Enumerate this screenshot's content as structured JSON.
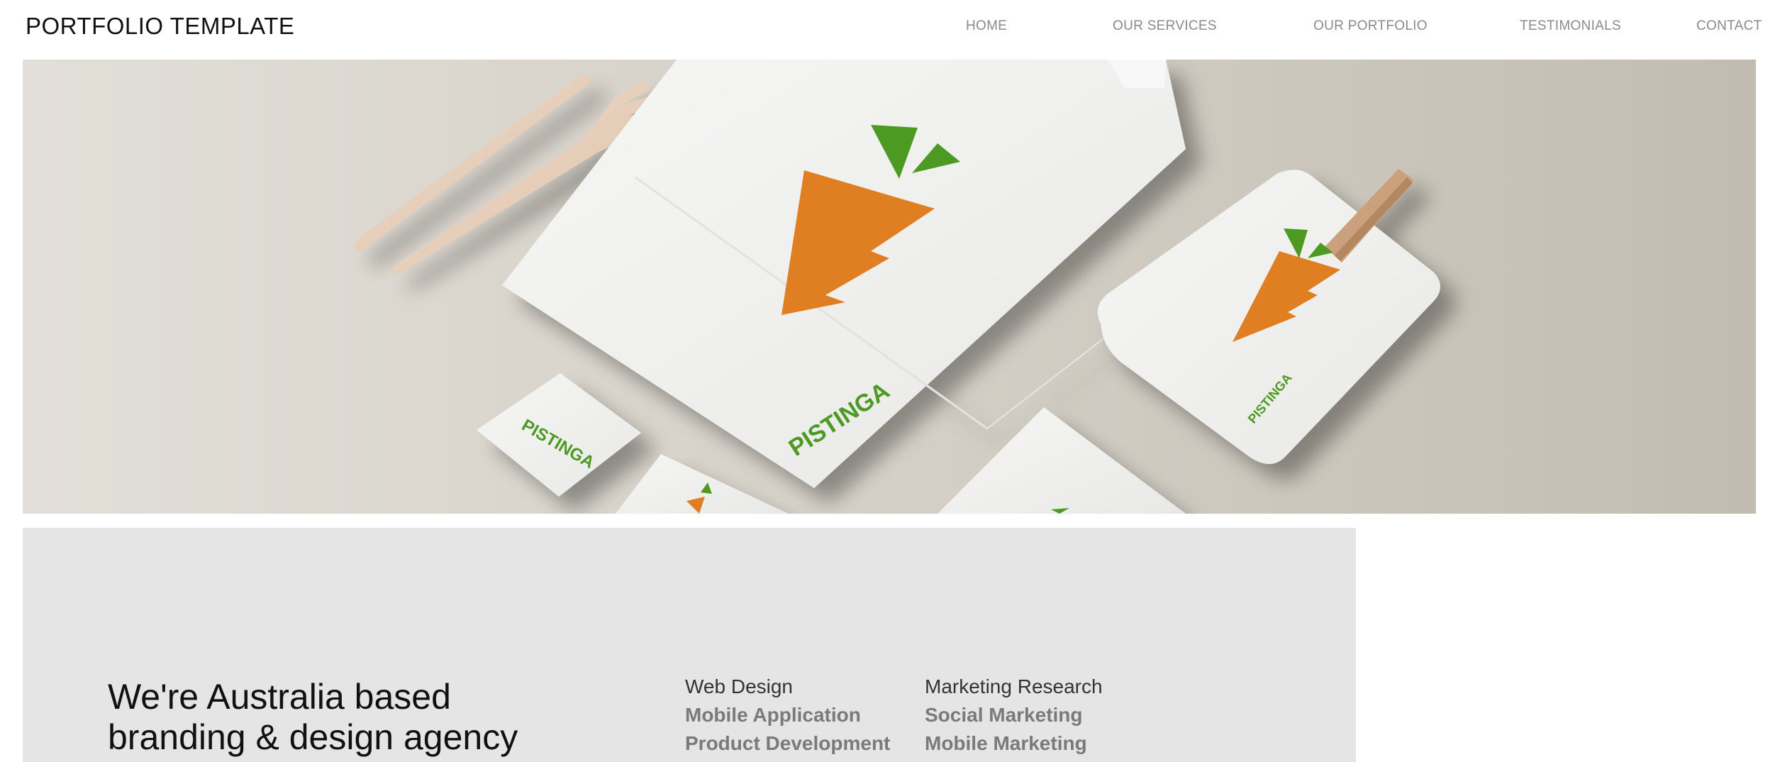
{
  "header": {
    "brand": "PORTFOLIO TEMPLATE",
    "nav": {
      "home": "HOME",
      "services": "OUR SERVICES",
      "portfolio": "OUR PORTFOLIO",
      "testimonials": "TESTIMONIALS",
      "contact": "CONTACT"
    }
  },
  "hero": {
    "logo_text": "PISTINGA",
    "colors": {
      "carrot": "#e07f22",
      "leaf": "#4e9a22",
      "paper": "#f3f3f2",
      "wood": "#e9d4c0"
    }
  },
  "about": {
    "heading_line1": "We're Australia based",
    "heading_line2": "branding & design agency",
    "services_col1": [
      "Web Design",
      "Mobile Application",
      "Product Development"
    ],
    "services_col2": [
      "Marketing Research",
      "Social Marketing",
      "Mobile Marketing"
    ]
  },
  "colors": {
    "about_bg": "#e5e5e5",
    "nav_text": "#8a8a8a",
    "brand_text": "#111111"
  }
}
